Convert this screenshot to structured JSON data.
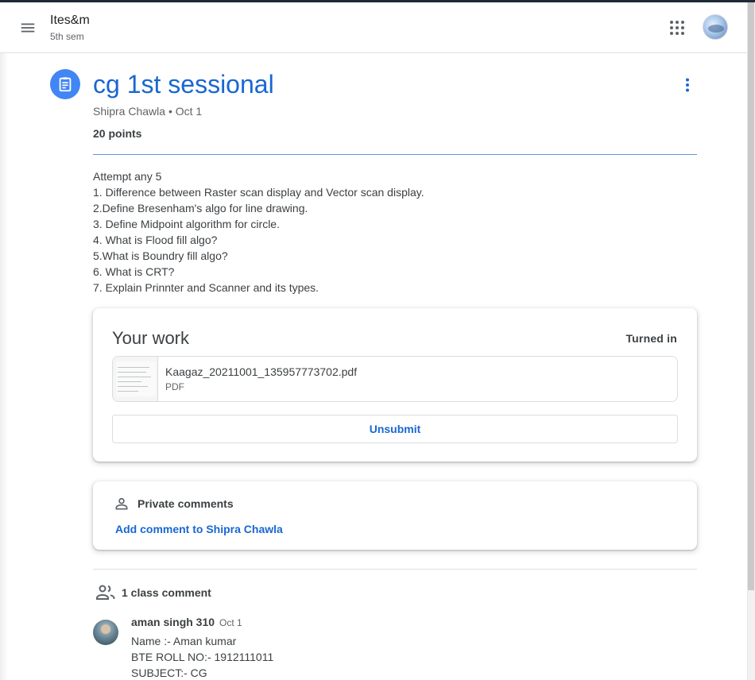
{
  "header": {
    "class_name": "Ites&m",
    "class_section": "5th sem"
  },
  "assignment": {
    "title": "cg 1st sessional",
    "meta": "Shipra Chawla • Oct 1",
    "points": "20 points",
    "description_lines": [
      "Attempt any 5",
      "1. Difference between Raster scan display and Vector scan display.",
      "2.Define Bresenham's algo for line drawing.",
      "3. Define Midpoint algorithm for circle.",
      "4. What is Flood fill algo?",
      "5.What is Boundry fill algo?",
      "6. What is CRT?",
      "7. Explain Prinnter and Scanner and its types."
    ]
  },
  "your_work": {
    "title": "Your work",
    "status": "Turned in",
    "attachment": {
      "name": "Kaagaz_20211001_135957773702.pdf",
      "type": "PDF"
    },
    "unsubmit_label": "Unsubmit"
  },
  "private_comments": {
    "label": "Private comments",
    "add_label": "Add comment to Shipra Chawla"
  },
  "class_comments": {
    "label": "1 class comment",
    "items": [
      {
        "author": "aman singh 310",
        "date": "Oct 1",
        "lines": [
          "Name :- Aman kumar",
          "BTE ROLL NO:- 1912111011",
          "SUBJECT:- CG"
        ]
      }
    ]
  },
  "colors": {
    "accent": "#1967d2",
    "icon_bg": "#4285f4",
    "text": "#3c4043",
    "muted": "#5f6368"
  },
  "icons": {
    "menu": "hamburger-icon",
    "apps": "apps-grid-icon",
    "assignment": "assignment-icon",
    "more": "more-vert-icon",
    "person": "person-icon",
    "people": "people-icon"
  }
}
